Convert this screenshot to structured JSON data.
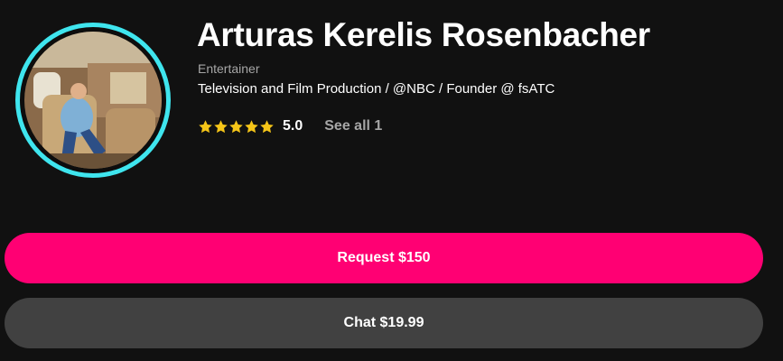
{
  "profile": {
    "name": "Arturas Kerelis Rosenbacher",
    "category": "Entertainer",
    "bio": "Television and Film Production / @NBC / Founder @ fsATC",
    "avatar_ring_color": "#3fe5ee"
  },
  "rating": {
    "stars": 5,
    "value": "5.0",
    "see_all_label": "See all 1",
    "star_color": "#f5c518",
    "star_icon": "star-icon"
  },
  "actions": {
    "request_label": "Request $150",
    "request_color": "#ff0073",
    "chat_label": "Chat $19.99",
    "chat_color": "#414141"
  }
}
